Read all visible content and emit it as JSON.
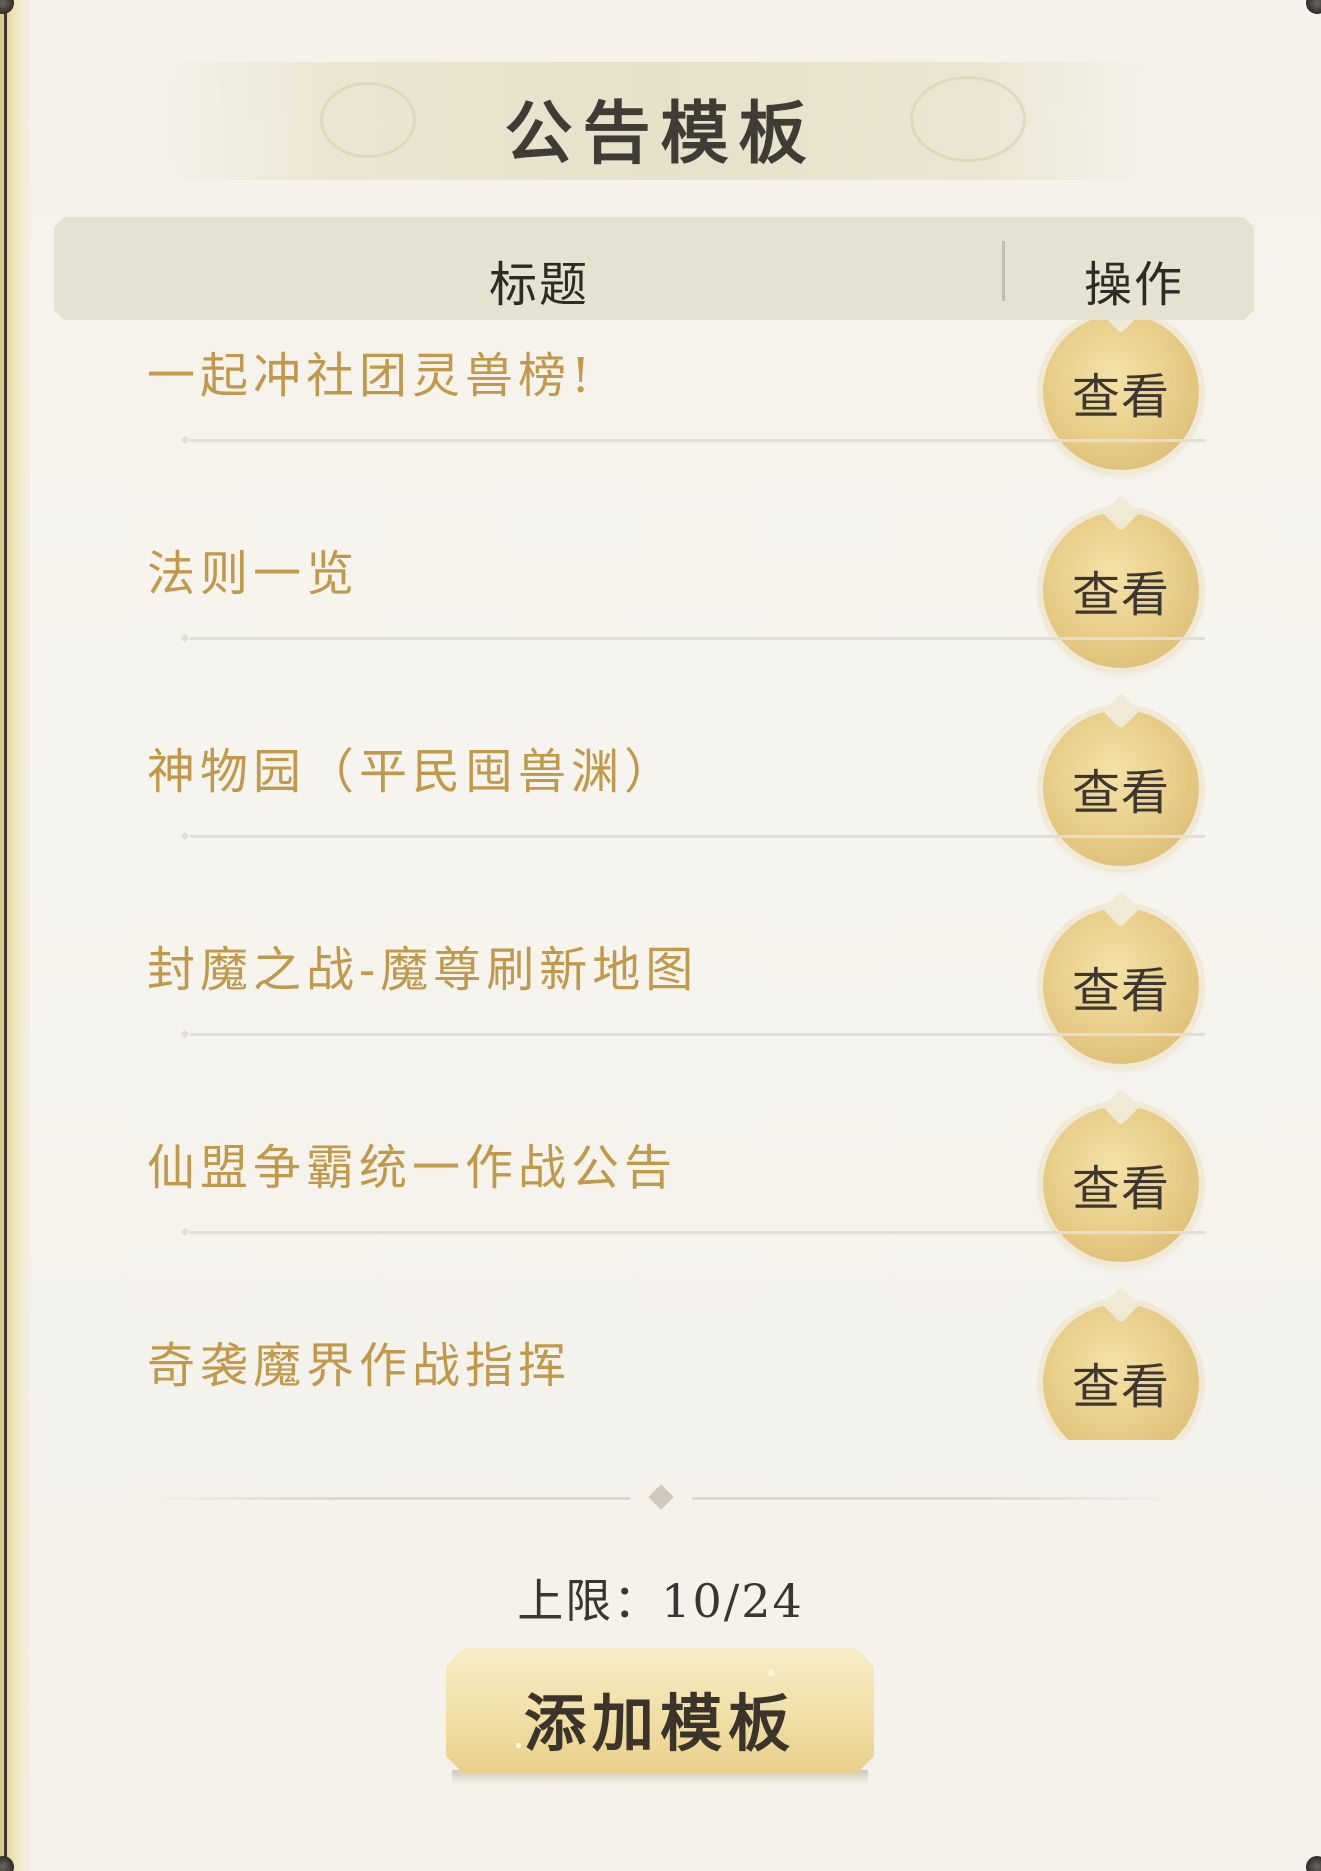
{
  "header": {
    "title": "公告模板"
  },
  "table": {
    "col_title": "标题",
    "col_action": "操作"
  },
  "rows": [
    {
      "title": "一起冲社团灵兽榜!",
      "action": "查看"
    },
    {
      "title": "法则一览",
      "action": "查看"
    },
    {
      "title": "神物园（平民囤兽渊）",
      "action": "查看"
    },
    {
      "title": "封魔之战-魔尊刷新地图",
      "action": "查看"
    },
    {
      "title": "仙盟争霸统一作战公告",
      "action": "查看"
    },
    {
      "title": "奇袭魔界作战指挥",
      "action": "查看"
    }
  ],
  "footer": {
    "limit": "上限：10/24",
    "add_label": "添加模板"
  },
  "colors": {
    "row_text": "#c09a4a",
    "title_text": "#3f3b35",
    "button_gold": "#e6cb85"
  }
}
